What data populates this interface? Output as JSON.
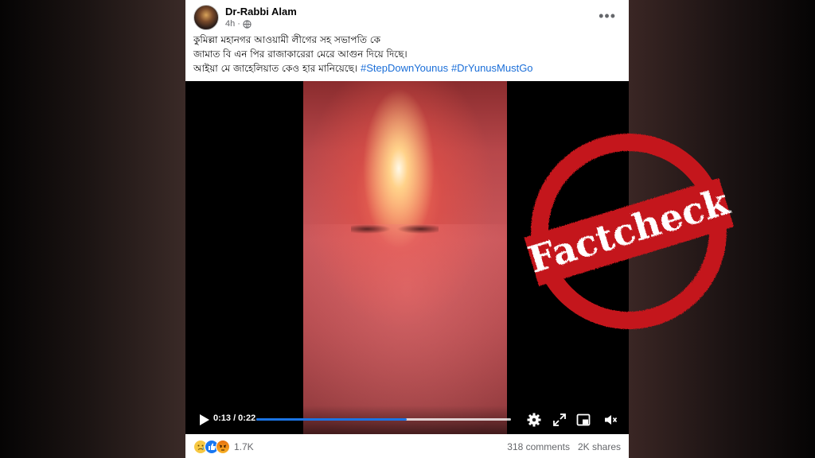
{
  "post": {
    "author": "Dr-Rabbi Alam",
    "time": "4h",
    "privacy_icon": "globe-icon",
    "more_icon": "more-horizontal-icon",
    "text_lines": [
      "কুমিল্লা মহানগর আওয়ামী লীগের সহ সভাপতি কে",
      "জামাত বি এন পির রাজাকারেরা মেরে আগুন দিয়ে দিছে।",
      "আইয়া মে জাহেলিয়াত কেও হার মানিয়েছে।"
    ],
    "hashtags": [
      "#StepDownYounus",
      "#DrYunusMustGo"
    ]
  },
  "video": {
    "current_time": "0:13",
    "duration": "0:22",
    "time_display": "0:13 / 0:22",
    "progress": 0.59,
    "buffered": 1.0,
    "icons": [
      "play-icon",
      "settings-icon",
      "fullscreen-icon",
      "picture-in-picture-icon",
      "volume-muted-icon"
    ]
  },
  "stamp": {
    "text": "Factcheck",
    "color": "#c4161c"
  },
  "footer": {
    "reaction_icons": [
      "sad-reaction-icon",
      "like-reaction-icon",
      "angry-reaction-icon"
    ],
    "reaction_count": "1.7K",
    "comments": "318 comments",
    "shares": "2K shares"
  },
  "colors": {
    "accent": "#1b74e4",
    "hashtag": "#1a6ed8",
    "text": "#050505",
    "secondary_text": "#65676b"
  }
}
